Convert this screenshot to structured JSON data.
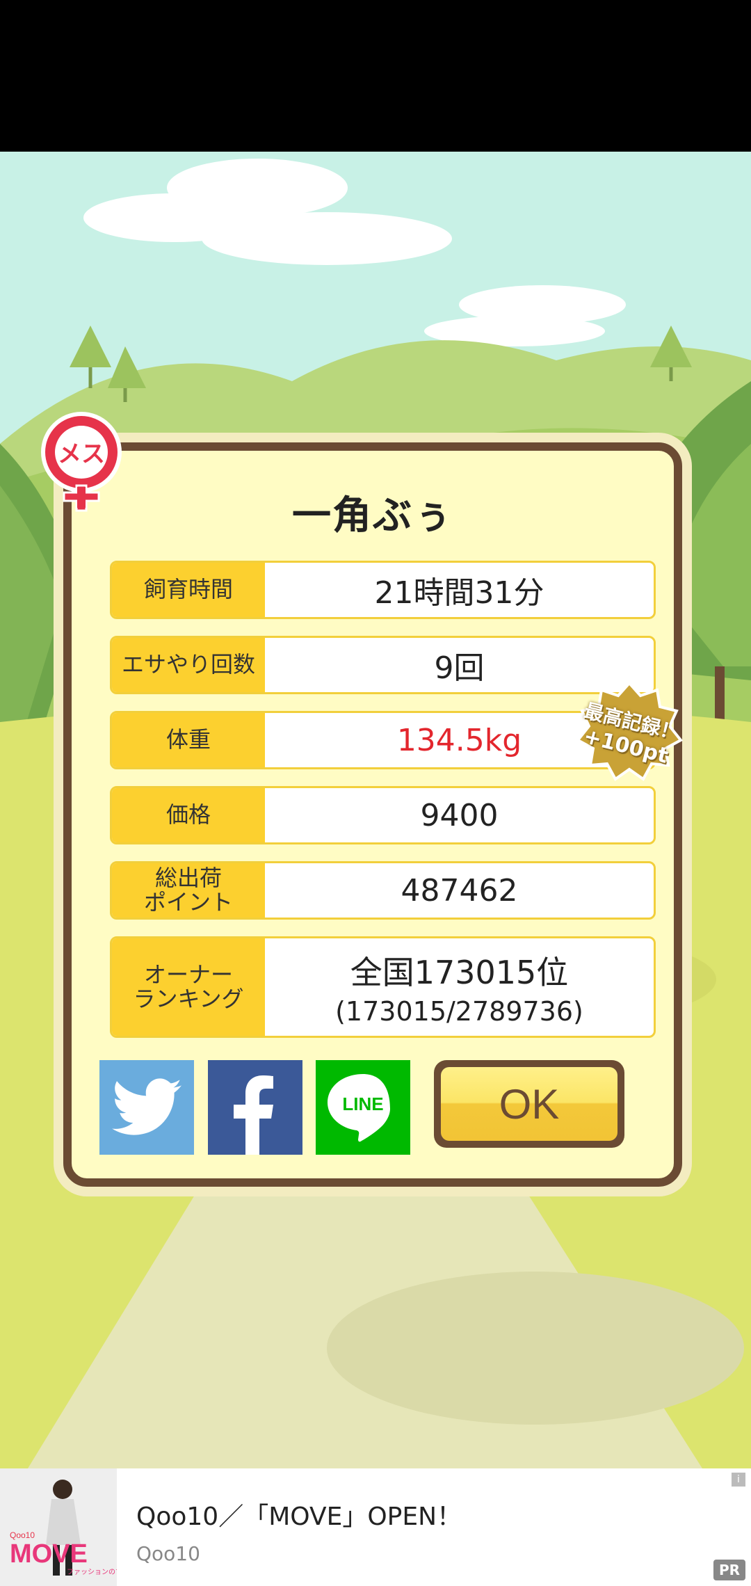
{
  "pet": {
    "name": "一角ぶぅ",
    "gender_label": "メス"
  },
  "stats": {
    "rows": [
      {
        "label": "飼育時間",
        "value": "21時間31分"
      },
      {
        "label": "エサやり回数",
        "value": "9回"
      },
      {
        "label": "体重",
        "value": "134.5kg"
      },
      {
        "label": "価格",
        "value": "9400"
      },
      {
        "label": "総出荷\nポイント",
        "value": "487462"
      }
    ],
    "ranking": {
      "label": "オーナー\nランキング",
      "value_main": "全国173015位",
      "value_sub": "(173015/2789736)"
    }
  },
  "record_badge": {
    "line1": "最高記録！",
    "line2": "+100pt"
  },
  "buttons": {
    "ok": "OK",
    "line": "LINE"
  },
  "ad": {
    "title": "Qoo10／「MOVE」OPEN！",
    "advertiser": "Qoo10",
    "pr": "PR",
    "info": "i",
    "thumb_brand": "MOVE",
    "thumb_small": "Qoo10",
    "thumb_caption": "ファッションのすべて"
  },
  "colors": {
    "dialog_bg": "#fffcc4",
    "label_bg": "#fcd02f",
    "frame": "#6b4b33",
    "weight_value": "#e3262d",
    "twitter": "#6aacdd",
    "facebook": "#3b5998",
    "line": "#00b900"
  }
}
